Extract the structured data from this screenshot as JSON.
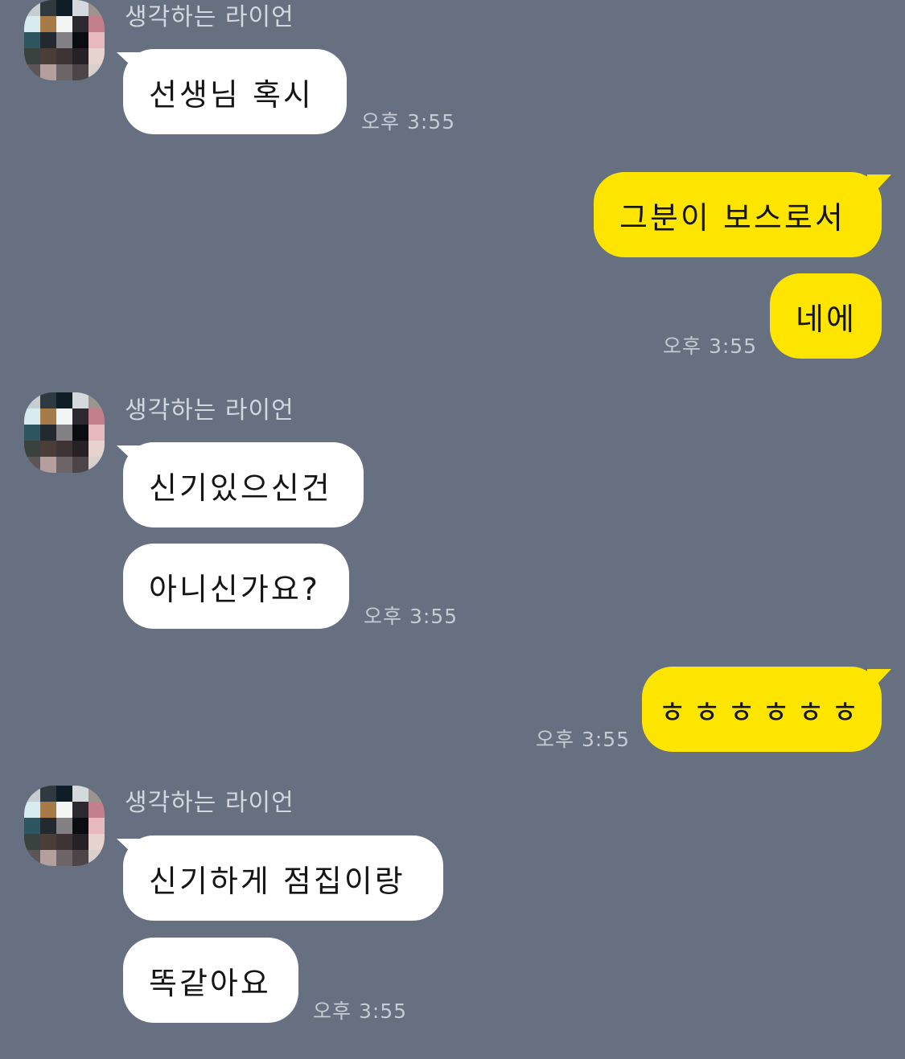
{
  "chat": {
    "messages": [
      {
        "sender": "생각하는 라이언",
        "text": "선생님 혹시",
        "time": "오후 3:55"
      },
      {
        "sender": "me",
        "text": "그분이 보스로서"
      },
      {
        "sender": "me",
        "text": "네에",
        "time": "오후 3:55"
      },
      {
        "sender": "생각하는 라이언",
        "text": "신기있으신건"
      },
      {
        "sender": "생각하는 라이언",
        "text": "아니신가요?",
        "time": "오후 3:55"
      },
      {
        "sender": "me",
        "text": "ㅎㅎㅎㅎㅎㅎ",
        "time": "오후 3:55"
      },
      {
        "sender": "생각하는 라이언",
        "text": "신기하게 점집이랑"
      },
      {
        "sender": "생각하는 라이언",
        "text": "똑같아요",
        "time": "오후 3:55"
      }
    ]
  },
  "colors": {
    "background": "#667080",
    "bubble_incoming": "#ffffff",
    "bubble_outgoing": "#fee500",
    "meta_text": "#c6cbd3"
  },
  "icons": {
    "avatar": "pixelated-profile-avatar"
  }
}
